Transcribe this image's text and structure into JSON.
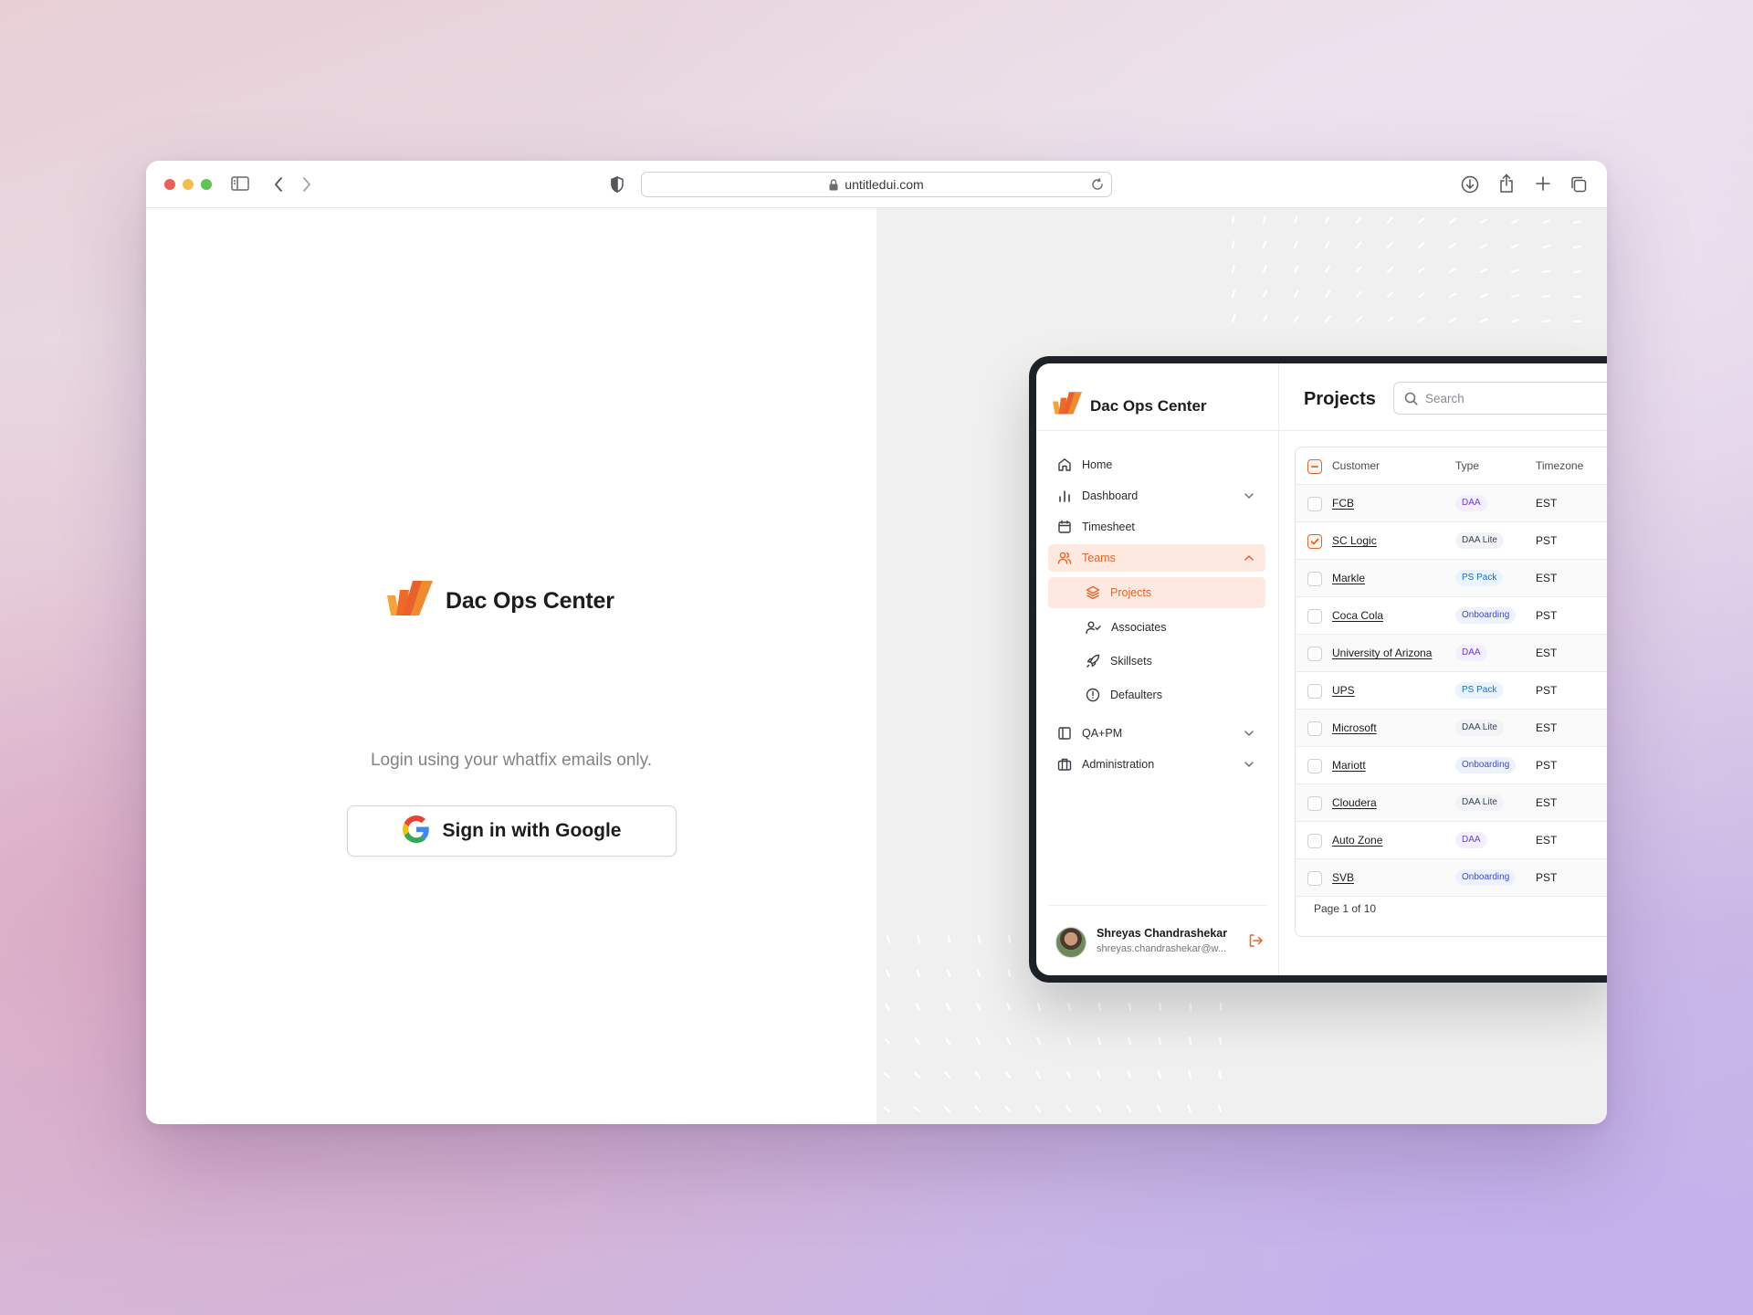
{
  "browser": {
    "url": "untitledui.com",
    "traffic_colors": [
      "#ec5f57",
      "#f4be4f",
      "#5fc454"
    ]
  },
  "login": {
    "brand_title": "Dac Ops Center",
    "subtitle": "Login using your whatfix emails only.",
    "google_button_label": "Sign in with Google"
  },
  "app": {
    "brand_title": "Dac Ops Center",
    "accent": "#e8632c",
    "nav": [
      {
        "label": "Home",
        "icon": "home-icon"
      },
      {
        "label": "Dashboard",
        "icon": "bar-chart-icon",
        "expandable": true
      },
      {
        "label": "Timesheet",
        "icon": "calendar-icon"
      },
      {
        "label": "Teams",
        "icon": "users-icon",
        "expanded": true,
        "active": true
      },
      {
        "label": "QA+PM",
        "icon": "layout-icon",
        "expandable": true
      },
      {
        "label": "Administration",
        "icon": "briefcase-icon",
        "expandable": true
      }
    ],
    "teams_sub": [
      {
        "label": "Projects",
        "icon": "layers-icon",
        "active": true
      },
      {
        "label": "Associates",
        "icon": "user-check-icon"
      },
      {
        "label": "Skillsets",
        "icon": "rocket-icon"
      },
      {
        "label": "Defaulters",
        "icon": "alert-circle-icon"
      }
    ],
    "user": {
      "name": "Shreyas Chandrashekar",
      "email": "shreyas.chandrashekar@w..."
    },
    "main": {
      "title": "Projects",
      "search_placeholder": "Search",
      "columns": [
        "Customer",
        "Type",
        "Timezone"
      ],
      "rows": [
        {
          "customer": "FCB",
          "type": "DAA",
          "tz": "EST",
          "checked": false
        },
        {
          "customer": "SC Logic",
          "type": "DAA Lite",
          "tz": "PST",
          "checked": true
        },
        {
          "customer": "Markle",
          "type": "PS Pack",
          "tz": "EST",
          "checked": false
        },
        {
          "customer": "Coca Cola",
          "type": "Onboarding",
          "tz": "PST",
          "checked": false
        },
        {
          "customer": "University of Arizona",
          "type": "DAA",
          "tz": "EST",
          "checked": false
        },
        {
          "customer": "UPS",
          "type": "PS Pack",
          "tz": "PST",
          "checked": false
        },
        {
          "customer": "Microsoft",
          "type": "DAA Lite",
          "tz": "EST",
          "checked": false
        },
        {
          "customer": "Mariott",
          "type": "Onboarding",
          "tz": "PST",
          "checked": false
        },
        {
          "customer": "Cloudera",
          "type": "DAA Lite",
          "tz": "EST",
          "checked": false
        },
        {
          "customer": "Auto Zone",
          "type": "DAA",
          "tz": "EST",
          "checked": false
        },
        {
          "customer": "SVB",
          "type": "Onboarding",
          "tz": "PST",
          "checked": false
        }
      ],
      "pagination": "Page 1 of 10"
    }
  }
}
